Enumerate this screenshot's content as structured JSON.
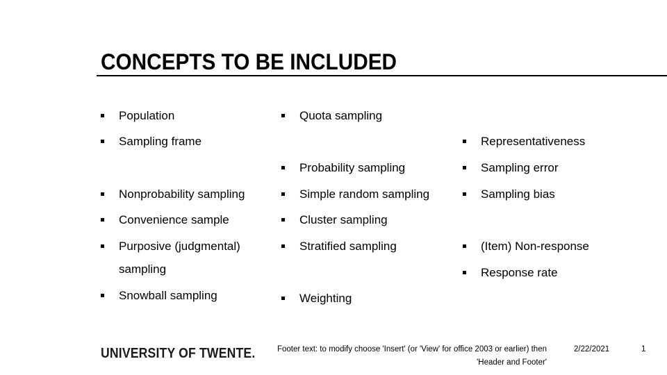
{
  "slide": {
    "title": "CONCEPTS TO BE INCLUDED",
    "column1": [
      {
        "label": "Population"
      },
      {
        "label": "Sampling frame"
      },
      {
        "label": "Nonprobability sampling"
      },
      {
        "label": "Convenience sample"
      },
      {
        "label": "Purposive (judgmental)",
        "continuation": "sampling"
      },
      {
        "label": "Snowball sampling"
      }
    ],
    "column2": [
      {
        "label": "Quota sampling"
      },
      {
        "label": "Probability sampling"
      },
      {
        "label": "Simple random sampling"
      },
      {
        "label": "Cluster sampling"
      },
      {
        "label": "Stratified sampling"
      },
      {
        "label": "Weighting"
      }
    ],
    "column3": [
      {
        "label": "Representativeness"
      },
      {
        "label": "Sampling error"
      },
      {
        "label": "Sampling bias"
      },
      {
        "label": "(Item) Non-response"
      },
      {
        "label": "Response rate"
      }
    ]
  },
  "footer": {
    "logo": "UNIVERSITY OF TWENTE.",
    "text": "Footer text: to modify choose 'Insert' (or 'View' for office 2003 or earlier) then 'Header and Footer'",
    "date": "2/22/2021",
    "page_number": "1"
  }
}
